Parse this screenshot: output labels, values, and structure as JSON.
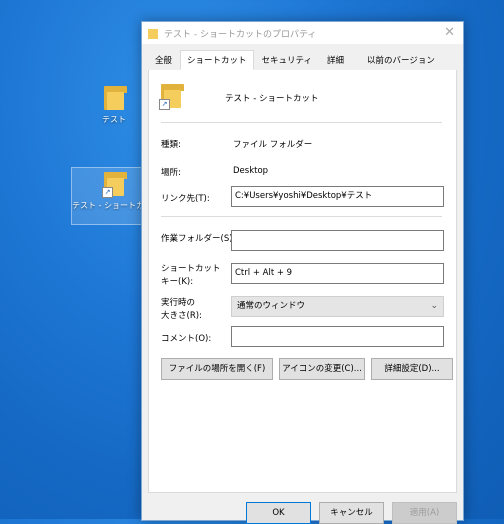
{
  "desktop": {
    "icon1_label": "テスト",
    "icon2_label": "テスト - ショートカット"
  },
  "dialog": {
    "title": "テスト - ショートカットのプロパティ",
    "close_glyph": "✕",
    "tabs": [
      "全般",
      "ショートカット",
      "セキュリティ",
      "詳細",
      "以前のバージョン"
    ],
    "name": "テスト - ショートカット",
    "type_label": "種類:",
    "type_value": "ファイル フォルダー",
    "location_label": "場所:",
    "location_value": "Desktop",
    "target_label": "リンク先(T):",
    "target_value": "C:¥Users¥yoshi¥Desktop¥テスト",
    "workdir_label": "作業フォルダー(S):",
    "workdir_value": "",
    "shortcut_key_label_line1": "ショートカット",
    "shortcut_key_label_line2": "キー(K):",
    "shortcut_key_value": "Ctrl + Alt + 9",
    "run_label_line1": "実行時の",
    "run_label_line2": "大きさ(R):",
    "run_value": "通常のウィンドウ",
    "comment_label": "コメント(O):",
    "comment_value": "",
    "open_location_button": "ファイルの場所を開く(F)",
    "change_icon_button": "アイコンの変更(C)...",
    "advanced_button": "詳細設定(D)...",
    "ok_button": "OK",
    "cancel_button": "キャンセル",
    "apply_button": "適用(A)"
  }
}
